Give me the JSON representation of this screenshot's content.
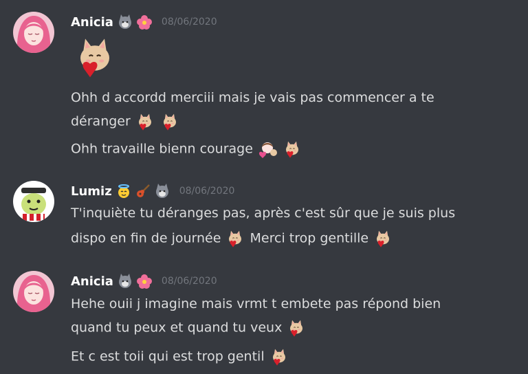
{
  "messages": [
    {
      "author": "Anicia",
      "badges": [
        "wolf-icon",
        "hibiscus-icon"
      ],
      "timestamp": "08/06/2020",
      "lines": [
        "Ohh d accordd merciii mais je vais pas commencer a te",
        "déranger",
        "Ohh travaille bienn courage"
      ]
    },
    {
      "author": "Lumiz",
      "badges": [
        "angel-face-icon",
        "guitar-icon",
        "wolf-icon"
      ],
      "timestamp": "08/06/2020",
      "lines": [
        "T'inquiète tu déranges pas, après c'est sûr que je suis plus",
        "dispo en fin de journée",
        "Merci trop gentille"
      ]
    },
    {
      "author": "Anicia",
      "badges": [
        "wolf-icon",
        "hibiscus-icon"
      ],
      "timestamp": "08/06/2020",
      "lines": [
        "Hehe ouii j imagine mais vrmt t embete pas répond bien",
        "quand tu peux et quand tu veux",
        "Et c est toii qui est trop gentil"
      ]
    }
  ],
  "colors": {
    "background": "#36393f",
    "username": "#ffffff",
    "timestamp": "#72767d",
    "text": "#dcddde"
  }
}
